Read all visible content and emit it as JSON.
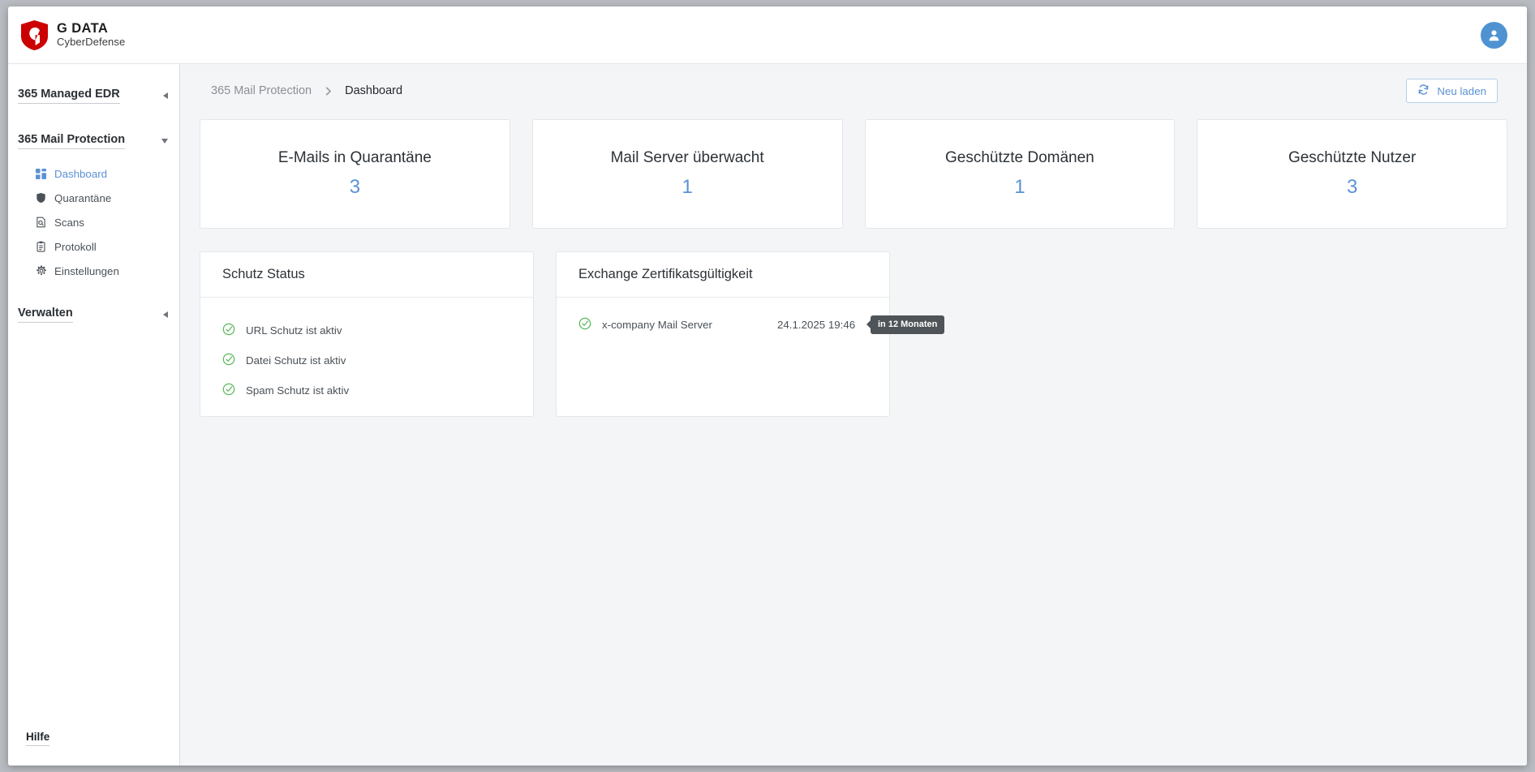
{
  "brand": {
    "title": "G DATA",
    "subtitle": "CyberDefense",
    "logo_color": "#cc0000"
  },
  "topbar": {
    "avatar_icon": "user-avatar-icon",
    "avatar_color": "#4e92d1"
  },
  "sidebar": {
    "groups": [
      {
        "label": "365 Managed EDR",
        "expanded": false,
        "chevron": "triangle-left-icon"
      },
      {
        "label": "365 Mail Protection",
        "expanded": true,
        "chevron": "triangle-down-icon"
      }
    ],
    "items": [
      {
        "label": "Dashboard",
        "icon": "grid-dashboard-icon",
        "active": true
      },
      {
        "label": "Quarantäne",
        "icon": "shield-icon",
        "active": false
      },
      {
        "label": "Scans",
        "icon": "document-search-icon",
        "active": false
      },
      {
        "label": "Protokoll",
        "icon": "clipboard-icon",
        "active": false
      },
      {
        "label": "Einstellungen",
        "icon": "gear-icon",
        "active": false
      }
    ],
    "manage_group": {
      "label": "Verwalten",
      "expanded": false,
      "chevron": "triangle-left-icon"
    },
    "help": "Hilfe"
  },
  "breadcrumb": {
    "parent": "365 Mail Protection",
    "separator_icon": "chevron-right-icon",
    "current": "Dashboard"
  },
  "toolbar": {
    "reload_label": "Neu laden",
    "reload_icon": "refresh-icon",
    "accent_color": "#5b92d4"
  },
  "stats": [
    {
      "title": "E-Mails in Quarantäne",
      "value": "3"
    },
    {
      "title": "Mail Server überwacht",
      "value": "1"
    },
    {
      "title": "Geschützte Domänen",
      "value": "1"
    },
    {
      "title": "Geschützte Nutzer",
      "value": "3"
    }
  ],
  "protection_panel": {
    "title": "Schutz Status",
    "items": [
      {
        "label": "URL Schutz ist aktiv",
        "icon": "check-circle-icon",
        "status_color": "#5cb85c"
      },
      {
        "label": "Datei Schutz ist aktiv",
        "icon": "check-circle-icon",
        "status_color": "#5cb85c"
      },
      {
        "label": "Spam Schutz ist aktiv",
        "icon": "check-circle-icon",
        "status_color": "#5cb85c"
      }
    ]
  },
  "certificate_panel": {
    "title": "Exchange Zertifikatsgültigkeit",
    "rows": [
      {
        "name": "x-company Mail Server",
        "date": "24.1.2025 19:46",
        "icon": "check-circle-icon",
        "status_color": "#5cb85c",
        "tooltip": "in 12 Monaten"
      }
    ]
  }
}
